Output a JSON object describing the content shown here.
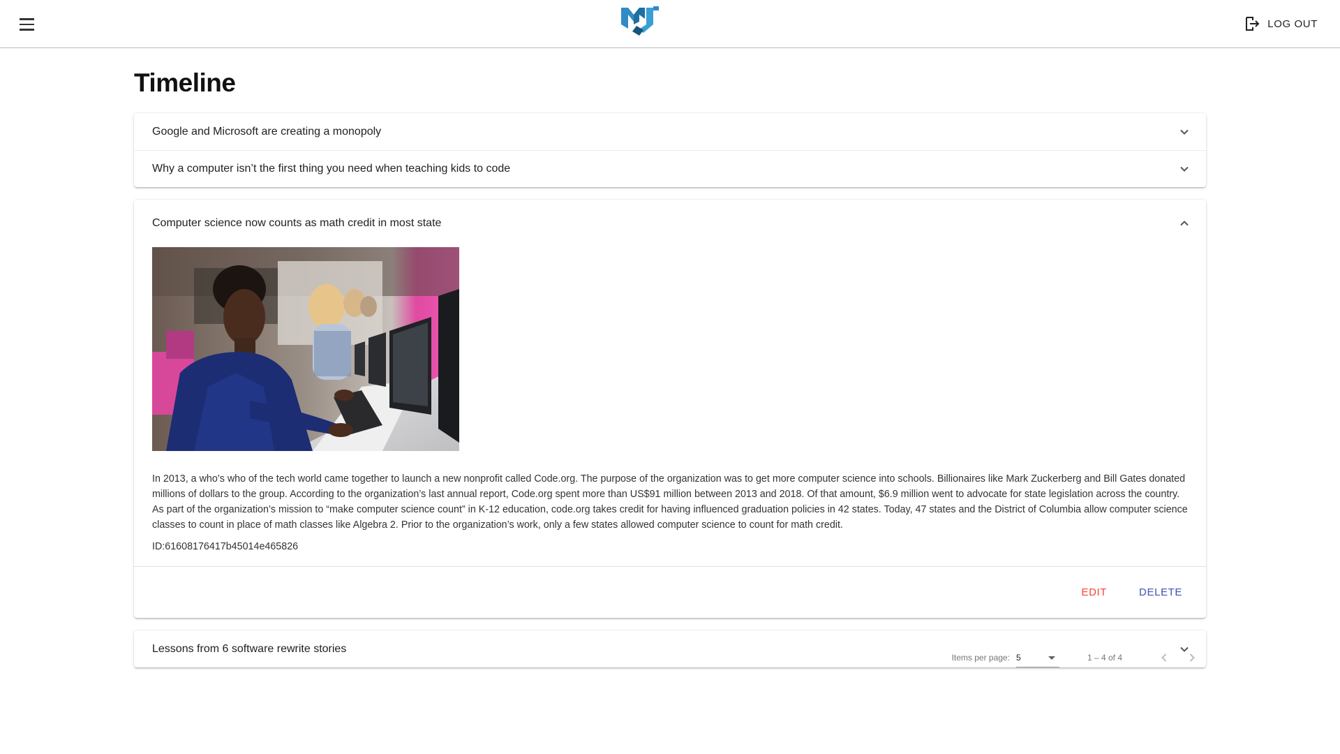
{
  "header": {
    "logo_icon": "mj-logo-icon",
    "menu_icon": "hamburger-menu-icon",
    "logout_icon": "logout-icon",
    "logout_label": "LOG OUT",
    "accent_color": "#2f8bc4"
  },
  "page": {
    "title": "Timeline"
  },
  "panels": [
    {
      "title": "Google and Microsoft are creating a monopoly",
      "expanded": false
    },
    {
      "title": "Why a computer isn’t the first thing you need when teaching kids to code",
      "expanded": false
    },
    {
      "title": "Computer science now counts as math credit in most state",
      "expanded": true,
      "image_alt": "students-at-computers-photo",
      "description": "In 2013, a who’s who of the tech world came together to launch a new nonprofit called Code.org. The purpose of the organization was to get more computer science into schools. Billionaires like Mark Zuckerberg and Bill Gates donated millions of dollars to the group. According to the organization’s last annual report, Code.org spent more than US$91 million between 2013 and 2018. Of that amount, $6.9 million went to advocate for state legislation across the country. As part of the organization’s mission to “make computer science count” in K-12 education, code.org takes credit for having influenced graduation policies in 42 states. Today, 47 states and the District of Columbia allow computer science classes to count in place of math classes like Algebra 2. Prior to the organization’s work, only a few states allowed computer science to count for math credit.",
      "id_text": "ID:61608176417b45014e465826",
      "edit_label": "EDIT",
      "delete_label": "DELETE"
    },
    {
      "title": "Lessons from 6 software rewrite stories",
      "expanded": false
    }
  ],
  "paginator": {
    "items_per_page_label": "Items per page:",
    "items_per_page_value": "5",
    "range_label": "1 – 4 of 4",
    "prev_icon": "chevron-left-icon",
    "next_icon": "chevron-right-icon"
  },
  "colors": {
    "edit": "#f44336",
    "delete": "#3f51b5"
  }
}
